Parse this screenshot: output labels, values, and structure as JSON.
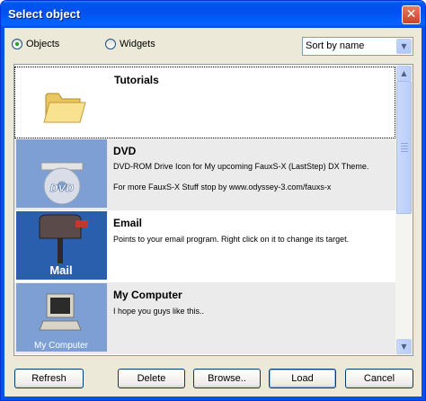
{
  "window": {
    "title": "Select object",
    "close_glyph": "✕"
  },
  "filter": {
    "options": [
      {
        "label": "Objects",
        "checked": true
      },
      {
        "label": "Widgets",
        "checked": false
      }
    ],
    "sort": {
      "selected": "Sort by name",
      "arrow": "▼"
    }
  },
  "items": [
    {
      "title": "Tutorials",
      "desc": "",
      "desc2": "",
      "icon": "folder-icon"
    },
    {
      "title": "DVD",
      "desc": "DVD-ROM Drive Icon for My upcoming FauxS-X (LastStep) DX Theme.",
      "desc2": "For more FauxS-X Stuff stop by www.odyssey-3.com/fauxs-x",
      "icon": "dvd-icon",
      "icon_caption": "DVD"
    },
    {
      "title": "Email",
      "desc": "Points to your email program. Right click on it to change its target.",
      "desc2": "",
      "icon": "mailbox-icon",
      "icon_caption": "Mail"
    },
    {
      "title": "My Computer",
      "desc": "I hope you guys like this..",
      "desc2": "",
      "icon": "computer-icon",
      "icon_caption": "My Computer"
    }
  ],
  "scrollbar": {
    "up": "▲",
    "down": "▼"
  },
  "buttons": {
    "refresh": "Refresh",
    "delete": "Delete",
    "browse": "Browse..",
    "load": "Load",
    "cancel": "Cancel"
  },
  "colors": {
    "titlebar": "#0053ee",
    "thumb_bg": "#2a68b8",
    "window_bg": "#ece9d8"
  }
}
